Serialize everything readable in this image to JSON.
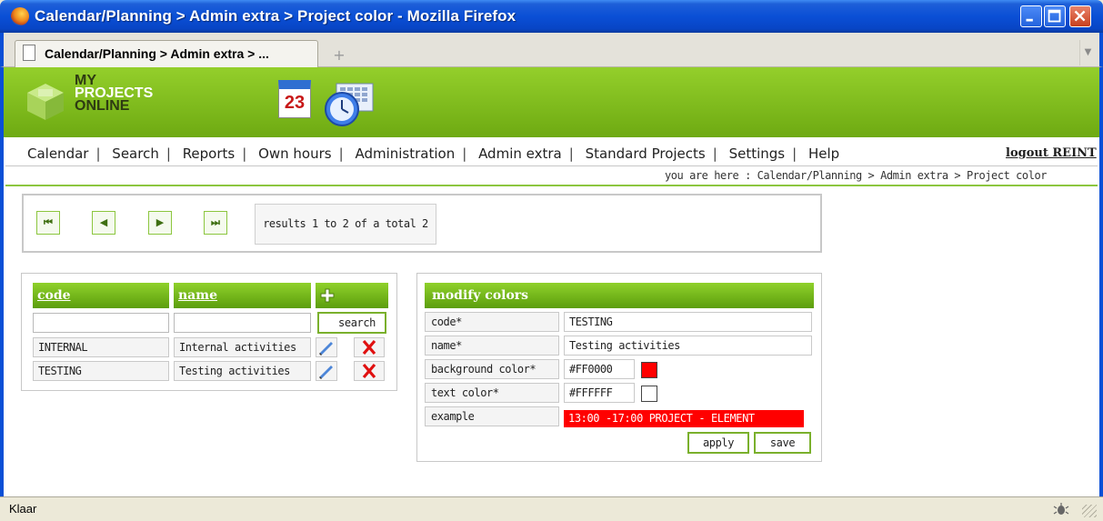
{
  "window": {
    "title": "Calendar/Planning > Admin extra > Project color - Mozilla Firefox"
  },
  "browser": {
    "tab_label": "Calendar/Planning > Admin extra > ...",
    "new_tab": "+",
    "status": "Klaar"
  },
  "logo": {
    "line1": "MY",
    "line2": "PROJECTS",
    "line3": "ONLINE"
  },
  "calendar_icon_day": "23",
  "nav": {
    "items": [
      "Calendar",
      "Search",
      "Reports",
      "Own hours",
      "Administration",
      "Admin extra",
      "Standard Projects",
      "Settings",
      "Help"
    ],
    "logout": "logout REINT"
  },
  "breadcrumb": "you are here : Calendar/Planning > Admin extra > Project color",
  "pager": {
    "first": "⏮",
    "prev": "◀",
    "next": "▶",
    "last": "⏭",
    "results": "results 1 to 2 of a total 2"
  },
  "project_list": {
    "col_code": "code",
    "col_name": "name",
    "search_button": "search",
    "rows": [
      {
        "code": "INTERNAL",
        "name": "Internal activities"
      },
      {
        "code": "TESTING",
        "name": "Testing activities"
      }
    ]
  },
  "modify": {
    "header": "modify colors",
    "fields": [
      {
        "label": "code*",
        "value": "TESTING"
      },
      {
        "label": "name*",
        "value": "Testing activities"
      },
      {
        "label": "background color*",
        "value": "#FF0000"
      },
      {
        "label": "text color*",
        "value": "#FFFFFF"
      },
      {
        "label": "example",
        "value": "13:00 -17:00 PROJECT - ELEMENT"
      }
    ],
    "apply_button": "apply",
    "save_button": "save"
  },
  "colors": {
    "brand_green": "#7ab02c",
    "background_color": "#FF0000",
    "text_color": "#FFFFFF"
  }
}
